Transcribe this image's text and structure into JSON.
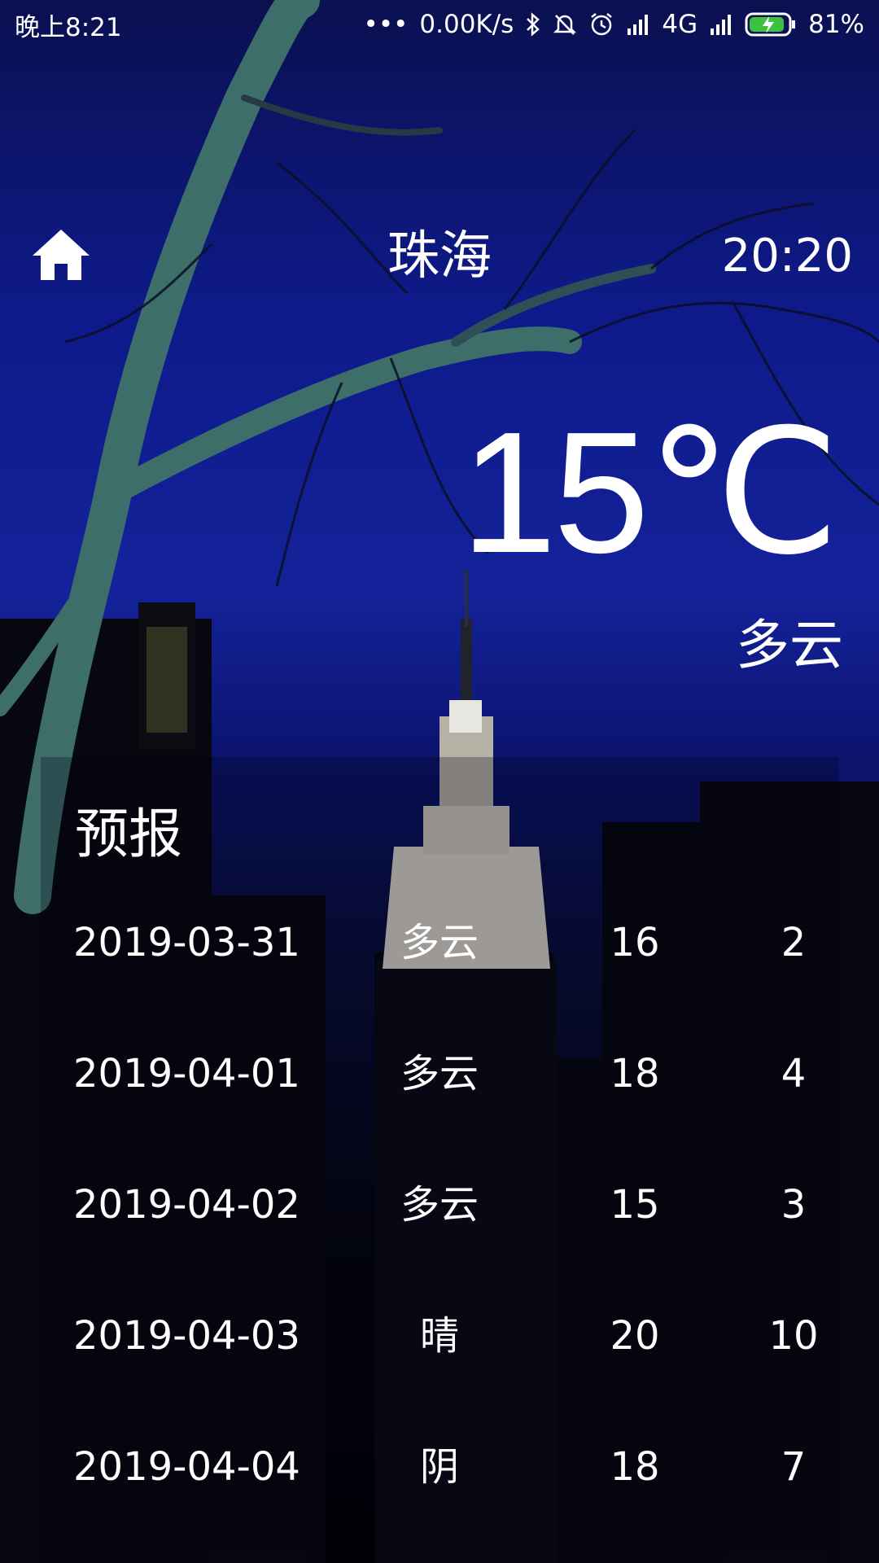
{
  "status_bar": {
    "time": "晚上8:21",
    "net_speed": "0.00K/s",
    "network": "4G",
    "battery": "81%"
  },
  "header": {
    "city": "珠海",
    "update_time": "20:20"
  },
  "now": {
    "temperature": "15℃",
    "condition": "多云"
  },
  "forecast": {
    "title": "预报",
    "items": [
      {
        "date": "2019-03-31",
        "cond": "多云",
        "max": "16",
        "min": "2"
      },
      {
        "date": "2019-04-01",
        "cond": "多云",
        "max": "18",
        "min": "4"
      },
      {
        "date": "2019-04-02",
        "cond": "多云",
        "max": "15",
        "min": "3"
      },
      {
        "date": "2019-04-03",
        "cond": "晴",
        "max": "20",
        "min": "10"
      },
      {
        "date": "2019-04-04",
        "cond": "阴",
        "max": "18",
        "min": "7"
      }
    ]
  }
}
